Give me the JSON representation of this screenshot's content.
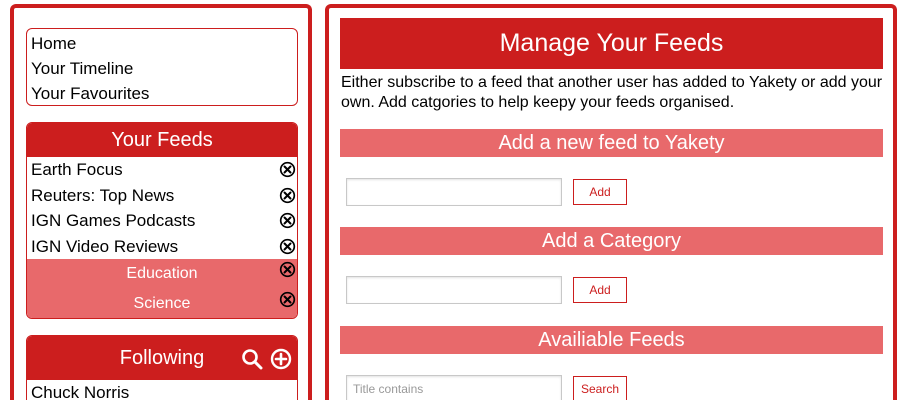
{
  "nav": {
    "items": [
      {
        "label": "Home"
      },
      {
        "label": "Your Timeline"
      },
      {
        "label": "Your Favourites"
      }
    ]
  },
  "feeds": {
    "title": "Your Feeds",
    "items": [
      {
        "label": "Earth Focus"
      },
      {
        "label": "Reuters: Top News"
      },
      {
        "label": "IGN Games Podcasts"
      },
      {
        "label": "IGN Video Reviews"
      }
    ],
    "categories": [
      {
        "label": "Education"
      },
      {
        "label": "Science"
      }
    ],
    "remove_icon": "close-circle-icon"
  },
  "following": {
    "title": "Following",
    "search_icon": "search-icon",
    "add_icon": "plus-circle-icon",
    "items": [
      {
        "label": "Chuck Norris"
      }
    ]
  },
  "main": {
    "title": "Manage Your Feeds",
    "intro": "Either subscribe to a feed that another user has added to Yakety or add your own. Add catgories to help keepy your feeds organised.",
    "add_feed": {
      "heading": "Add a new feed to Yakety",
      "value": "",
      "placeholder": "",
      "button": "Add"
    },
    "add_category": {
      "heading": "Add a Category",
      "value": "",
      "placeholder": "",
      "button": "Add"
    },
    "available": {
      "heading": "Availiable Feeds",
      "value": "",
      "placeholder": "Title contains",
      "button": "Search"
    }
  },
  "colors": {
    "accent": "#cc1e1e",
    "accent_light": "#e8696b",
    "text": "#000000",
    "background": "#ffffff"
  }
}
